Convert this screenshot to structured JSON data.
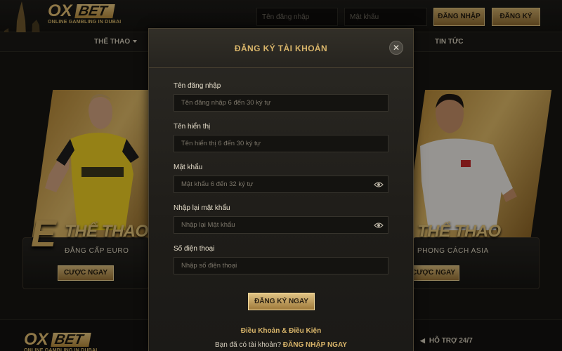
{
  "brand": {
    "logo_ox": "OX",
    "logo_bet": "BET",
    "tagline": "ONLINE GAMBLING IN DUBAI"
  },
  "header": {
    "username_placeholder": "Tên đăng nhập",
    "password_placeholder": "Mật khẩu",
    "login_label": "ĐĂNG NHẬP",
    "register_label": "ĐĂNG KÝ"
  },
  "nav": {
    "sports_label": "THỂ THAO",
    "news_label": "TIN TỨC"
  },
  "cards": {
    "left": {
      "letter": "E",
      "title": "THỂ THAO",
      "subtitle": "ĐẲNG CẤP EURO",
      "button": "CƯỢC NGAY"
    },
    "right": {
      "title": "THỂ THAO",
      "subtitle": "PHONG CÁCH ASIA",
      "button": "CƯỢC NGAY"
    }
  },
  "modal": {
    "title": "ĐĂNG KÝ TÀI KHOẢN",
    "close_symbol": "✕",
    "fields": [
      {
        "label": "Tên đăng nhập",
        "placeholder": "Tên đăng nhập 6 đến 30 ký tự"
      },
      {
        "label": "Tên hiển thị",
        "placeholder": "Tên hiển thị 6 đến 30 ký tự"
      },
      {
        "label": "Mật khẩu",
        "placeholder": "Mật khẩu 6 đến 32 ký tự"
      },
      {
        "label": "Nhập lại mật khẩu",
        "placeholder": "Nhập lại Mật khẩu"
      },
      {
        "label": "Số điện thoại",
        "placeholder": "Nhập số điện thoại"
      }
    ],
    "submit_label": "ĐĂNG KÝ NGAY",
    "terms_label": "Điều Khoản & Điều Kiện",
    "have_account_text": "Bạn đã có tài khoản?",
    "login_now_label": "ĐĂNG NHẬP NGAY"
  },
  "footer": {
    "support_label": "HỖ TRỢ 24/7"
  },
  "colors": {
    "gold": "#d9b56a",
    "background": "#171613",
    "panel": "#2b2924"
  },
  "icons": [
    "skyline-icon",
    "caret-down-icon",
    "close-icon",
    "eye-icon",
    "chevron-left-icon"
  ]
}
